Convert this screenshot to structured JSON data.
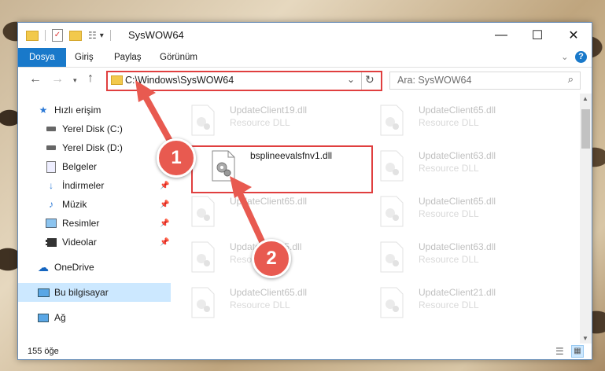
{
  "window": {
    "title": "SysWOW64",
    "controls": {
      "minimize": "—",
      "maximize": "☐",
      "close": "✕"
    }
  },
  "ribbon": {
    "tabs": [
      {
        "label": "Dosya"
      },
      {
        "label": "Giriş"
      },
      {
        "label": "Paylaş"
      },
      {
        "label": "Görünüm"
      }
    ],
    "help_label": "?"
  },
  "address": {
    "path": "C:\\Windows\\SysWOW64",
    "search_placeholder": "Ara: SysWOW64"
  },
  "sidebar": {
    "items": [
      {
        "label": "Hızlı erişim",
        "icon": "star-icon"
      },
      {
        "label": "Yerel Disk (C:)",
        "icon": "drive-icon"
      },
      {
        "label": "Yerel Disk (D:)",
        "icon": "drive-icon"
      },
      {
        "label": "Belgeler",
        "icon": "documents-icon"
      },
      {
        "label": "İndirmeler",
        "icon": "download-icon"
      },
      {
        "label": "Müzik",
        "icon": "music-icon"
      },
      {
        "label": "Resimler",
        "icon": "pictures-icon"
      },
      {
        "label": "Videolar",
        "icon": "video-icon"
      },
      {
        "label": "OneDrive",
        "icon": "cloud-icon"
      },
      {
        "label": "Bu bilgisayar",
        "icon": "computer-icon"
      },
      {
        "label": "Ağ",
        "icon": "network-icon"
      }
    ]
  },
  "files": {
    "highlighted": {
      "name": "bsplineevalsfnv1.dll"
    },
    "ghosts": [
      {
        "name": "UpdateClient19.dll",
        "desc": "Resource DLL"
      },
      {
        "name": "UpdateClient65.dll",
        "desc": "Resource DLL"
      },
      {
        "name": "UpdateClient63.dll",
        "desc": "Resource DLL"
      },
      {
        "name": "UpdateClient65.dll",
        "desc": "Resource DLL"
      },
      {
        "name": "UpdateClient65.dll",
        "desc": "Resource DLL"
      },
      {
        "name": "UpdateClient5.dll",
        "desc": "Resource DLL"
      },
      {
        "name": "UpdateClient63.dll",
        "desc": "Resource DLL"
      },
      {
        "name": "UpdateClient65.dll",
        "desc": "Resource DLL"
      },
      {
        "name": "UpdateClient21.dll",
        "desc": "Resource DLL"
      }
    ]
  },
  "status": {
    "count": "155 öğe"
  },
  "annotations": {
    "step1": "1",
    "step2": "2",
    "color": "#e85a50"
  }
}
